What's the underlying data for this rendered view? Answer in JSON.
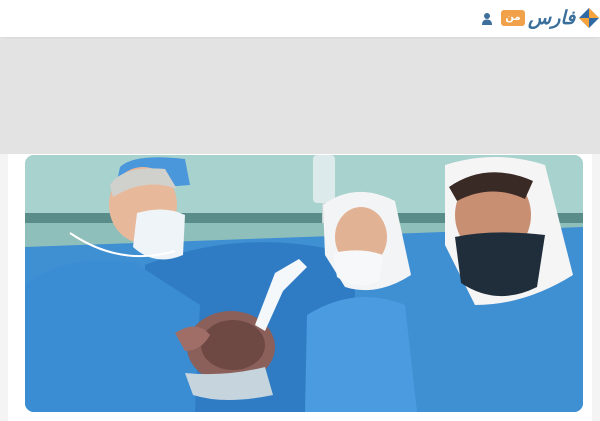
{
  "header": {
    "logo_text": "فارس",
    "man_badge_label": "من",
    "icons": {
      "user": "user-icon",
      "logo_mark": "fars-logo-icon"
    },
    "colors": {
      "logo_text": "#3a6f9b",
      "badge": "#f0a14a",
      "logo_mark_orange": "#f5a33a",
      "logo_mark_blue": "#2f6aa5",
      "user_icon": "#3d6f9c"
    }
  },
  "main": {
    "photo": {
      "subject": "surgeons-holding-newborn-photo"
    }
  }
}
